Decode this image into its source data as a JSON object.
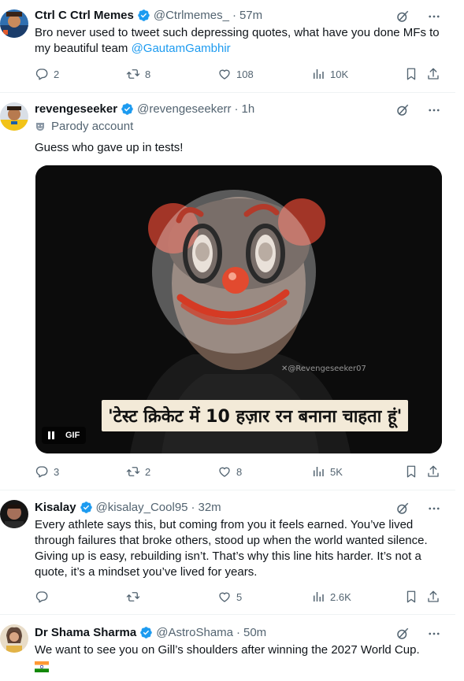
{
  "colors": {
    "link": "#1d9bf0",
    "muted": "#536471",
    "verified": "#1d9bf0"
  },
  "tweets": [
    {
      "name": "Ctrl C Ctrl Memes",
      "handle": "@Ctrlmemes_",
      "dot": "·",
      "time": "57m",
      "text": "Bro never used to tweet such depressing quotes, what have you done MFs to my beautiful team ",
      "mention": "@GautamGambhir",
      "replies": "2",
      "reposts": "8",
      "likes": "108",
      "views": "10K"
    },
    {
      "name": "revengeseeker",
      "handle": "@revengeseekerr",
      "dot": "·",
      "time": "1h",
      "parody_label": "Parody account",
      "text": "Guess who gave up in tests!",
      "media": {
        "caption": "'टेस्ट क्रिकेट में 10 हज़ार रन बनाना चाहता हूं'",
        "watermark": "✕@Revengeseeker07",
        "badge": "GIF"
      },
      "replies": "3",
      "reposts": "2",
      "likes": "8",
      "views": "5K"
    },
    {
      "name": "Kisalay",
      "handle": "@kisalay_Cool95",
      "dot": "·",
      "time": "32m",
      "text": "Every athlete says this, but coming from you it feels earned. You’ve lived through failures that broke others, stood up when the world wanted silence. Giving up is easy, rebuilding isn’t. That’s why this line hits harder. It’s not a quote, it’s a mindset you’ve lived for years.",
      "replies": "",
      "reposts": "",
      "likes": "5",
      "views": "2.6K"
    },
    {
      "name": "Dr Shama Sharma",
      "handle": "@AstroShama",
      "dot": "·",
      "time": "50m",
      "text": "We want to see you on Gill’s shoulders after winning the 2027 World Cup.",
      "flag": "india-flag-emoji"
    }
  ]
}
